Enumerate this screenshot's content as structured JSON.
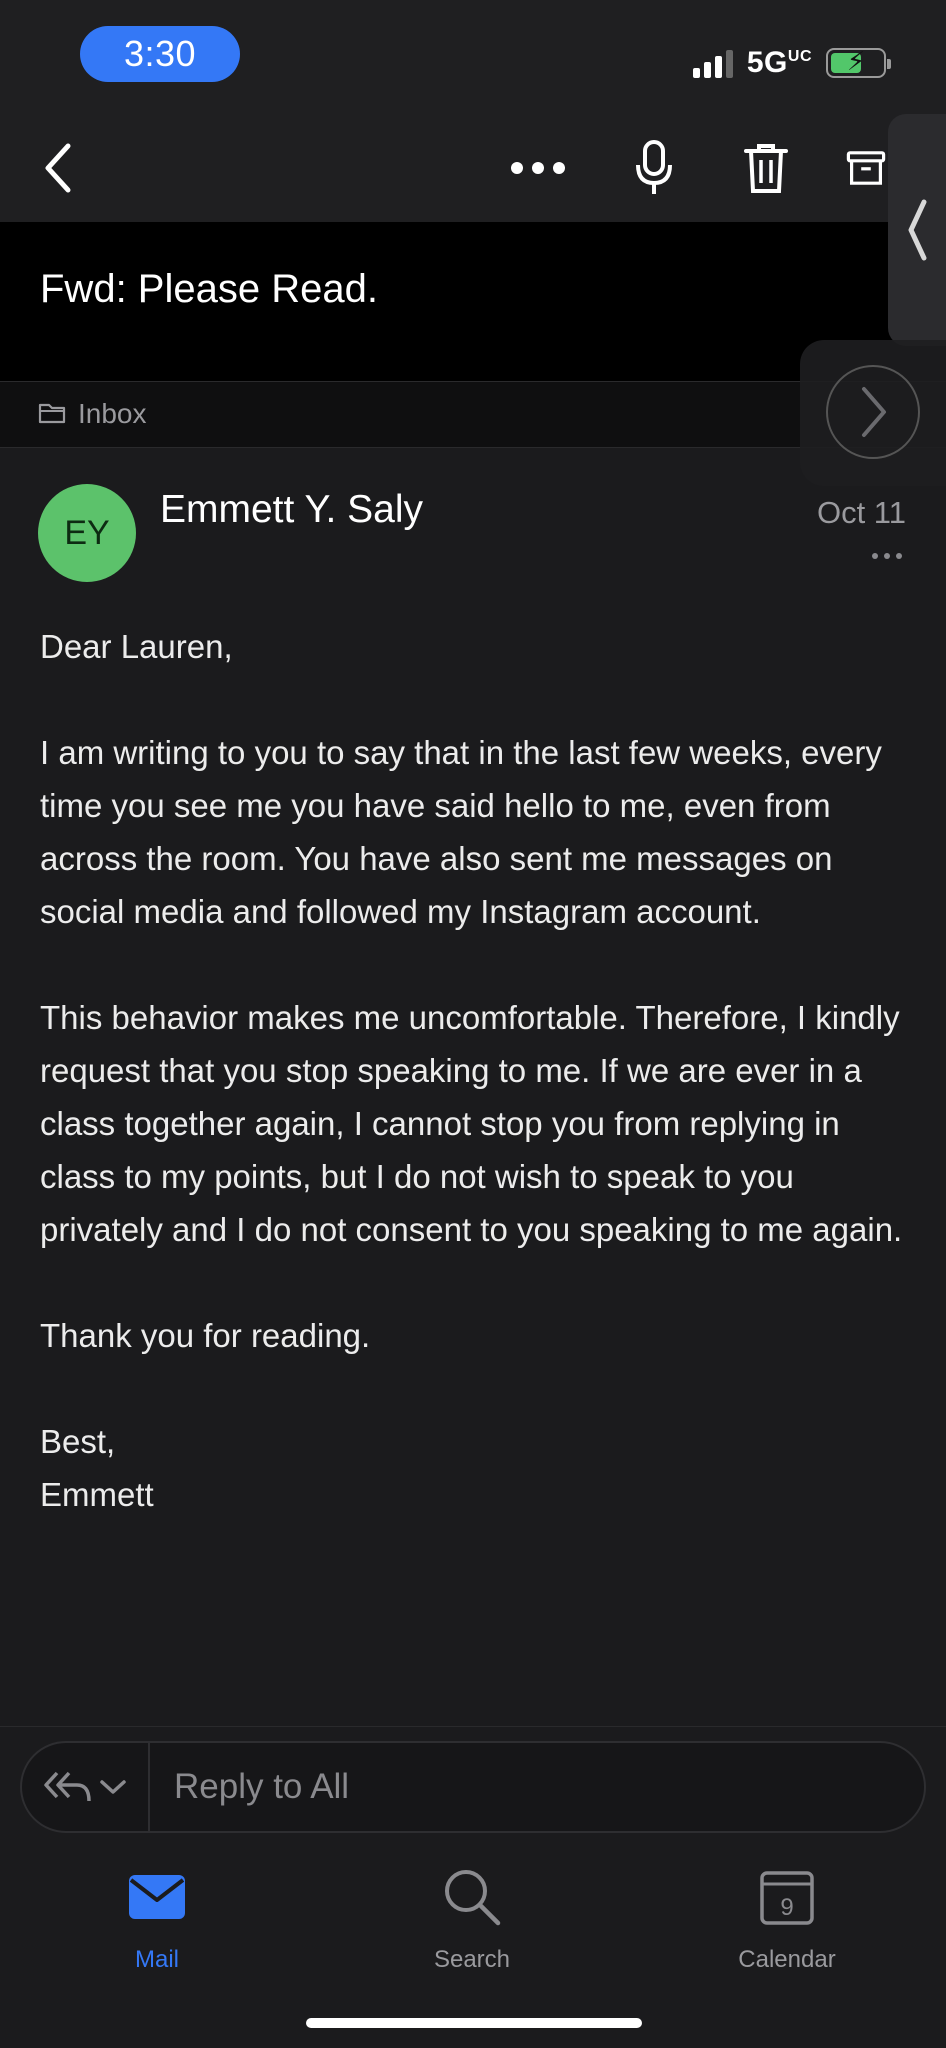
{
  "status_bar": {
    "time": "3:30",
    "network": "5G",
    "network_sup": "UC"
  },
  "toolbar": {
    "back_icon": "chevron-left-icon",
    "more_icon": "ellipsis-icon",
    "mic_icon": "microphone-icon",
    "delete_icon": "trash-icon",
    "archive_icon": "archive-icon"
  },
  "email": {
    "subject": "Fwd: Please Read.",
    "folder": "Inbox",
    "sender_initials": "EY",
    "sender_name": "Emmett Y. Saly",
    "date": "Oct 11",
    "greeting": "Dear Lauren,",
    "paragraph1": "I am writing to you to say that in the last few weeks, every time you see me you have said hello to me, even from across the room. You have also sent me messages on social media and followed my Instagram account.",
    "paragraph2": "This behavior makes me uncomfortable. Therefore, I kindly request that you stop speaking to me. If we are ever in a class together again, I cannot stop you from replying in class to my points, but I do not wish to speak to you privately and I do not consent to you speaking to me again.",
    "paragraph3": "Thank you for reading.",
    "signoff": "Best,",
    "signature": "Emmett"
  },
  "reply": {
    "placeholder": "Reply to All"
  },
  "tabs": [
    {
      "label": "Mail",
      "icon": "mail-icon",
      "active": true
    },
    {
      "label": "Search",
      "icon": "search-icon",
      "active": false
    },
    {
      "label": "Calendar",
      "icon": "calendar-icon",
      "day": "9",
      "active": false
    }
  ],
  "colors": {
    "accent": "#3478f6",
    "avatar": "#5cc26b",
    "battery": "#52c76a"
  }
}
